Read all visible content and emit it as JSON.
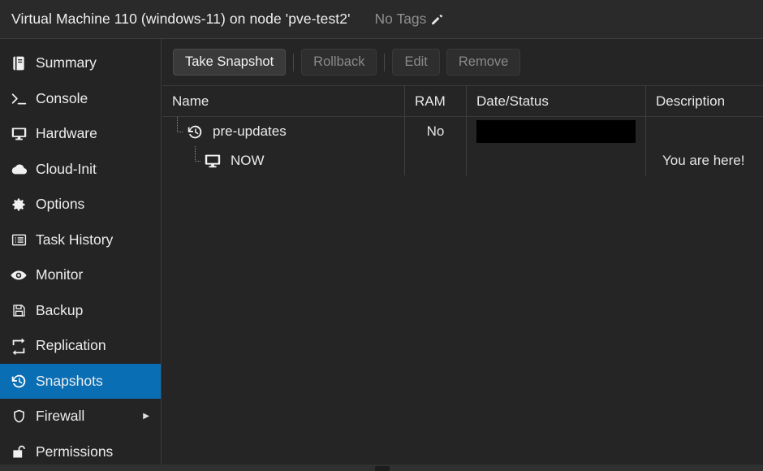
{
  "header": {
    "title": "Virtual Machine 110 (windows-11) on node 'pve-test2'",
    "tags_label": "No Tags",
    "edit_tags_icon": "pencil-icon"
  },
  "sidebar": {
    "items": [
      {
        "label": "Summary",
        "icon": "book-icon",
        "selected": false,
        "has_submenu": false
      },
      {
        "label": "Console",
        "icon": "terminal-icon",
        "selected": false,
        "has_submenu": false
      },
      {
        "label": "Hardware",
        "icon": "monitor-icon",
        "selected": false,
        "has_submenu": false
      },
      {
        "label": "Cloud-Init",
        "icon": "cloud-icon",
        "selected": false,
        "has_submenu": false
      },
      {
        "label": "Options",
        "icon": "gear-icon",
        "selected": false,
        "has_submenu": false
      },
      {
        "label": "Task History",
        "icon": "list-icon",
        "selected": false,
        "has_submenu": false
      },
      {
        "label": "Monitor",
        "icon": "eye-icon",
        "selected": false,
        "has_submenu": false
      },
      {
        "label": "Backup",
        "icon": "floppy-icon",
        "selected": false,
        "has_submenu": false
      },
      {
        "label": "Replication",
        "icon": "retweet-icon",
        "selected": false,
        "has_submenu": false
      },
      {
        "label": "Snapshots",
        "icon": "history-icon",
        "selected": true,
        "has_submenu": false
      },
      {
        "label": "Firewall",
        "icon": "shield-icon",
        "selected": false,
        "has_submenu": true
      },
      {
        "label": "Permissions",
        "icon": "unlock-icon",
        "selected": false,
        "has_submenu": false
      }
    ],
    "submenu_arrow": "▶"
  },
  "toolbar": {
    "take_snapshot_label": "Take Snapshot",
    "rollback_label": "Rollback",
    "edit_label": "Edit",
    "remove_label": "Remove",
    "take_snapshot_enabled": true,
    "rollback_enabled": false,
    "edit_enabled": false,
    "remove_enabled": false
  },
  "grid": {
    "columns": [
      {
        "key": "name",
        "label": "Name"
      },
      {
        "key": "ram",
        "label": "RAM"
      },
      {
        "key": "date",
        "label": "Date/Status"
      },
      {
        "key": "desc",
        "label": "Description"
      }
    ],
    "rows": [
      {
        "name": "pre-updates",
        "icon": "history-icon",
        "indent": 0,
        "ram": "No",
        "date": "",
        "date_redacted": true,
        "desc": ""
      },
      {
        "name": "NOW",
        "icon": "monitor-icon",
        "indent": 1,
        "ram": "",
        "date": "",
        "date_redacted": false,
        "desc": "You are here!"
      }
    ]
  },
  "colors": {
    "accent_blue": "#0a6eb4",
    "background": "#222222",
    "panel": "#252525",
    "redaction": "#000000",
    "muted_text": "#8e8e8e"
  }
}
